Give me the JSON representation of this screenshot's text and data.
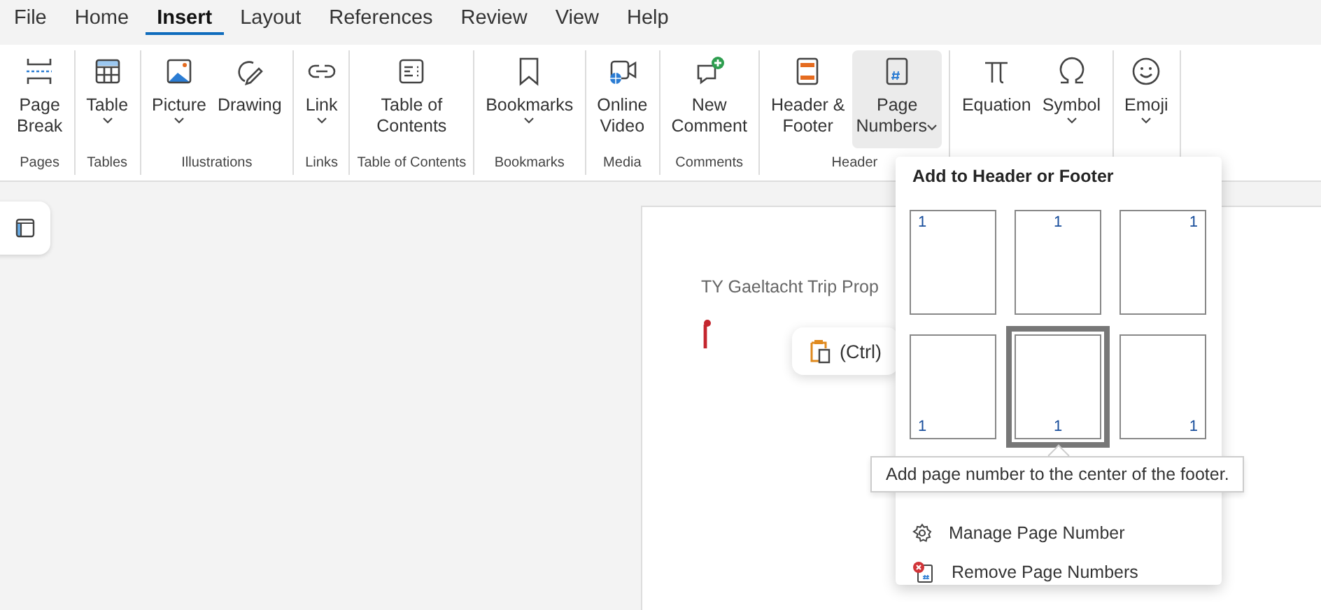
{
  "tabs": [
    {
      "label": "File",
      "selected": false
    },
    {
      "label": "Home",
      "selected": false
    },
    {
      "label": "Insert",
      "selected": true
    },
    {
      "label": "Layout",
      "selected": false
    },
    {
      "label": "References",
      "selected": false
    },
    {
      "label": "Review",
      "selected": false
    },
    {
      "label": "View",
      "selected": false
    },
    {
      "label": "Help",
      "selected": false
    }
  ],
  "ribbon": {
    "groups": [
      {
        "label": "Pages",
        "buttons": [
          {
            "kind": "page-break",
            "label": "Page Break",
            "dropdown": false,
            "selected": false
          }
        ]
      },
      {
        "label": "Tables",
        "buttons": [
          {
            "kind": "table",
            "label": "Table",
            "dropdown": true,
            "selected": false
          }
        ]
      },
      {
        "label": "Illustrations",
        "buttons": [
          {
            "kind": "picture",
            "label": "Picture",
            "dropdown": true,
            "selected": false
          },
          {
            "kind": "drawing",
            "label": "Drawing",
            "dropdown": false,
            "selected": false
          }
        ]
      },
      {
        "label": "Links",
        "buttons": [
          {
            "kind": "link",
            "label": "Link",
            "dropdown": true,
            "selected": false
          }
        ]
      },
      {
        "label": "Table of Contents",
        "buttons": [
          {
            "kind": "toc",
            "label": "Table of Contents",
            "dropdown": false,
            "selected": false
          }
        ]
      },
      {
        "label": "Bookmarks",
        "buttons": [
          {
            "kind": "bookmark",
            "label": "Bookmarks",
            "dropdown": true,
            "selected": false
          }
        ]
      },
      {
        "label": "Media",
        "buttons": [
          {
            "kind": "video",
            "label": "Online Video",
            "dropdown": false,
            "selected": false
          }
        ]
      },
      {
        "label": "Comments",
        "buttons": [
          {
            "kind": "comment",
            "label": "New Comment",
            "dropdown": false,
            "selected": false
          }
        ]
      },
      {
        "label": "Header",
        "buttons": [
          {
            "kind": "header",
            "label": "Header & Footer",
            "dropdown": false,
            "selected": false
          },
          {
            "kind": "page-number",
            "label": "Page Numbers",
            "dropdown": true,
            "selected": true
          }
        ]
      },
      {
        "buttons": [
          {
            "kind": "equation",
            "label": "Equation",
            "dropdown": false,
            "selected": false
          },
          {
            "kind": "symbol",
            "label": "Symbol",
            "dropdown": true,
            "selected": false
          }
        ]
      },
      {
        "buttons": [
          {
            "kind": "emoji",
            "label": "Emoji",
            "dropdown": true,
            "selected": false
          }
        ]
      }
    ]
  },
  "document": {
    "heading": "TY Gaeltacht Trip Prop",
    "paste_options": {
      "label": "(Ctrl)"
    }
  },
  "page_numbers_menu": {
    "title": "Add to Header or Footer",
    "positions": [
      {
        "number": "1",
        "selected": false
      },
      {
        "number": "1",
        "selected": false
      },
      {
        "number": "1",
        "selected": false
      },
      {
        "number": "1",
        "selected": false
      },
      {
        "number": "1",
        "selected": true
      },
      {
        "number": "1",
        "selected": false
      }
    ],
    "items": [
      {
        "kind": "manage",
        "label": "Manage Page Number"
      },
      {
        "kind": "remove",
        "label": "Remove Page Numbers"
      }
    ]
  },
  "tooltip": {
    "text": "Add page number to the center of the footer."
  }
}
